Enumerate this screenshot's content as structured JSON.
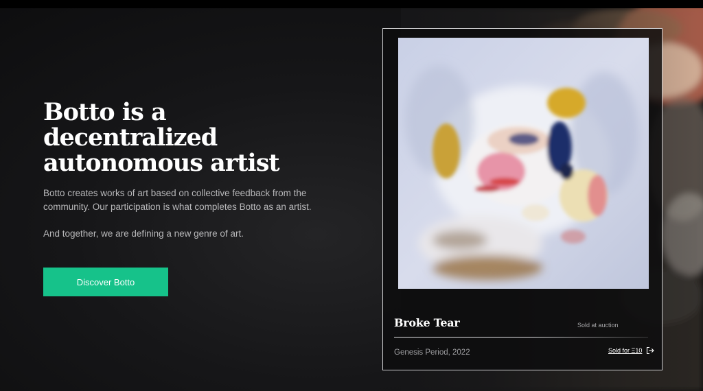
{
  "hero": {
    "headline": "Botto is a\ndecentralized\nautonomous artist",
    "description": "Botto creates works of art based on collective feedback from the community. Our participation is what completes Botto as an artist.",
    "tagline": "And together, we are defining a new genre of art.",
    "cta_label": "Discover Botto"
  },
  "artwork": {
    "title": "Broke Tear",
    "status": "Sold at auction",
    "period": "Genesis Period, 2022",
    "sold_link": "Sold for Ξ10",
    "sold_icon": "external-link-icon"
  },
  "colors": {
    "accent": "#16c28a",
    "background": "#161618",
    "text_primary": "#ffffff",
    "text_secondary": "#b8b8ba"
  }
}
